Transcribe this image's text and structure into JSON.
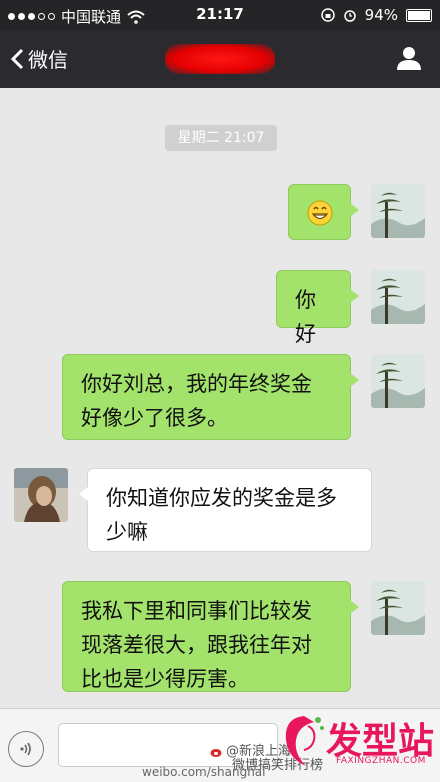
{
  "status_bar": {
    "carrier": "中国联通",
    "time": "21:17",
    "battery": "94%"
  },
  "nav": {
    "back_label": "微信"
  },
  "timestamp": "星期二 21:07",
  "messages": [
    {
      "side": "me",
      "type": "emoji",
      "icon": "grinning-face-emoji"
    },
    {
      "side": "me",
      "type": "text",
      "text": "你好"
    },
    {
      "side": "me",
      "type": "text",
      "text": "你好刘总，我的年终奖金好像少了很多。"
    },
    {
      "side": "other",
      "type": "text",
      "text": "你知道你应发的奖金是多少嘛"
    },
    {
      "side": "me",
      "type": "text",
      "text": "我私下里和同事们比较发现落差很大，跟我往年对比也是少得厉害。"
    }
  ],
  "watermark": {
    "weibo_handle": "@新浪上海",
    "weibo_sub": "微博搞笑排行榜",
    "footer_url": "weibo.com/shanghai",
    "site_name": "发型站",
    "site_domain": "FAXINGZHAN.COM"
  }
}
